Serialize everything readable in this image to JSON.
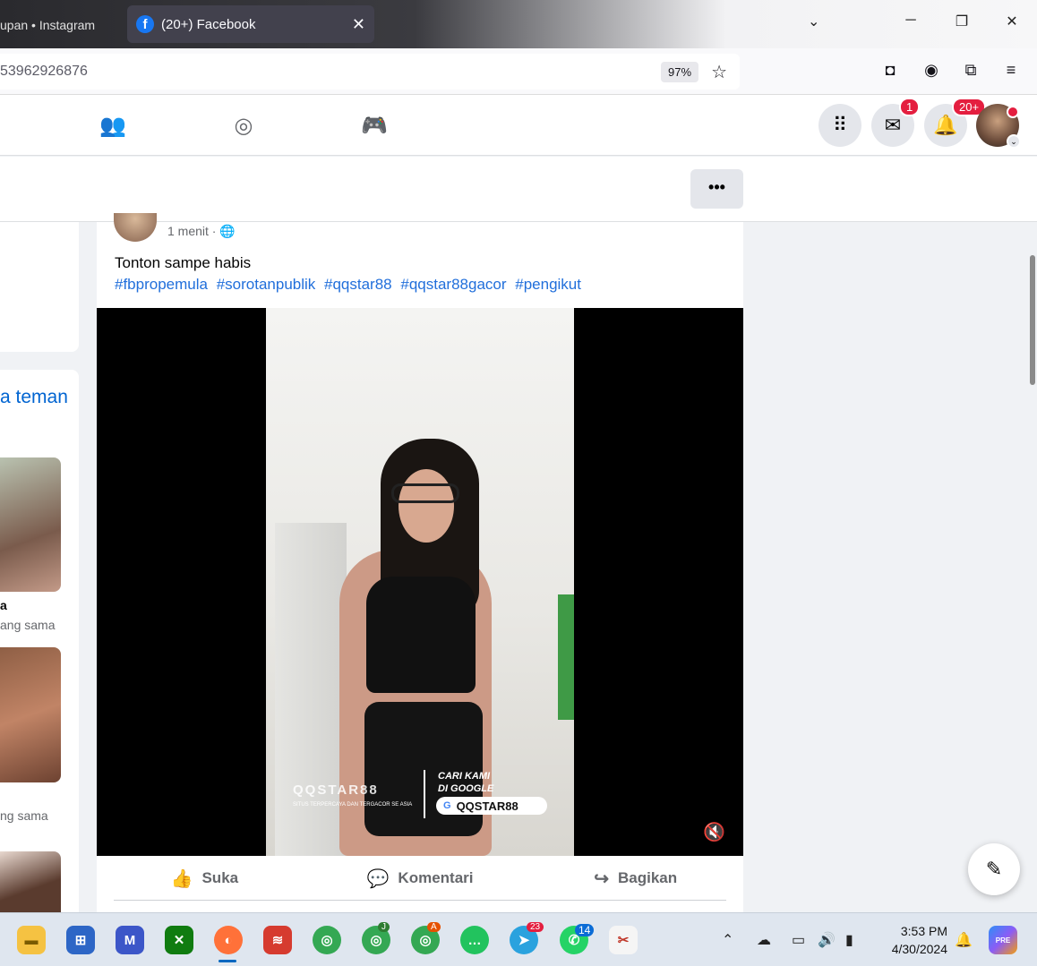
{
  "browser": {
    "prev_tab_title": "upan • Instagram",
    "active_tab_title": "(20+) Facebook",
    "url_text": "53962926876",
    "zoom": "97%"
  },
  "fb": {
    "messenger_badge": "1",
    "notif_badge": "20+",
    "accent": "#1877f2"
  },
  "left": {
    "friends_title": "a teman",
    "friend1_name": "a",
    "friend1_mutual": "ang sama",
    "friend2_mutual": "ng sama"
  },
  "post": {
    "time": "1 menit ·",
    "text": "Tonton sampe habis",
    "hashtags": [
      "#fbpropemula",
      "#sorotanpublik",
      "#qqstar88",
      "#qqstar88gacor",
      "#pengikut"
    ],
    "video": {
      "brand_text": "QQSTAR88",
      "tagline": "SITUS TERPERCAYA DAN TERGACOR SE ASIA",
      "cari_line1": "CARI KAMI",
      "cari_line2": "DI GOOGLE",
      "search_pill": "QQSTAR88"
    },
    "actions": {
      "like": "Suka",
      "comment": "Komentari",
      "share": "Bagikan"
    }
  },
  "taskbar": {
    "time": "3:53 PM",
    "date": "4/30/2024",
    "badges": {
      "chrome_j": "J",
      "chrome_a": "A",
      "telegram": "23",
      "whatsapp": "14"
    },
    "copilot_label": "PRE"
  }
}
